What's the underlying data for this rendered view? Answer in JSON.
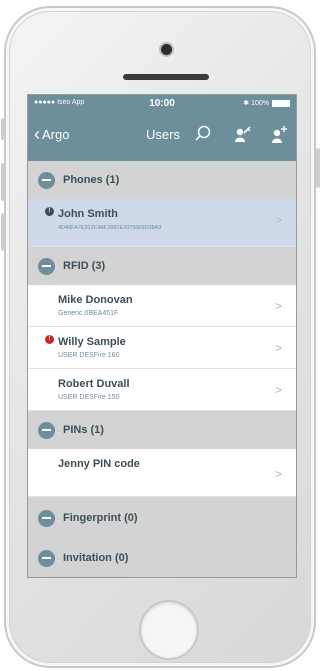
{
  "status_bar": {
    "carrier": "●●●●● Iseo App",
    "time": "10:00",
    "battery": "✱ 100%"
  },
  "nav": {
    "back_label": "Argo",
    "title": "Users"
  },
  "icons": {
    "search": "search-icon",
    "key_user": "key-user-icon",
    "add_user": "add-user-icon",
    "collapse": "collapse-icon",
    "chevron": "chevron-right-icon"
  },
  "colors": {
    "header": "#6d8e9b",
    "section_bg": "#d3d3d3",
    "selected_row": "#cfd9ea",
    "alert_red": "#c8282a"
  },
  "sections": {
    "phones": {
      "label": "Phones (1)",
      "items": [
        {
          "name": "John Smith",
          "sub": "4D49FA7E912C46F2987E3375009D38A3",
          "badge": "!"
        }
      ]
    },
    "rfid": {
      "label": "RFID (3)",
      "items": [
        {
          "name": "Mike Donovan",
          "sub": "Generic 0BEA451F"
        },
        {
          "name": "Willy Sample",
          "sub": "USER DESFire 160",
          "badge": "!"
        },
        {
          "name": "Robert Duvall",
          "sub": "USER DESFire 150"
        }
      ]
    },
    "pins": {
      "label": "PINs (1)",
      "items": [
        {
          "name": "Jenny PIN code"
        }
      ]
    },
    "fingerprint": {
      "label": "Fingerprint (0)"
    },
    "invitation": {
      "label": "Invitation (0)"
    }
  },
  "chevron_glyph": ">"
}
